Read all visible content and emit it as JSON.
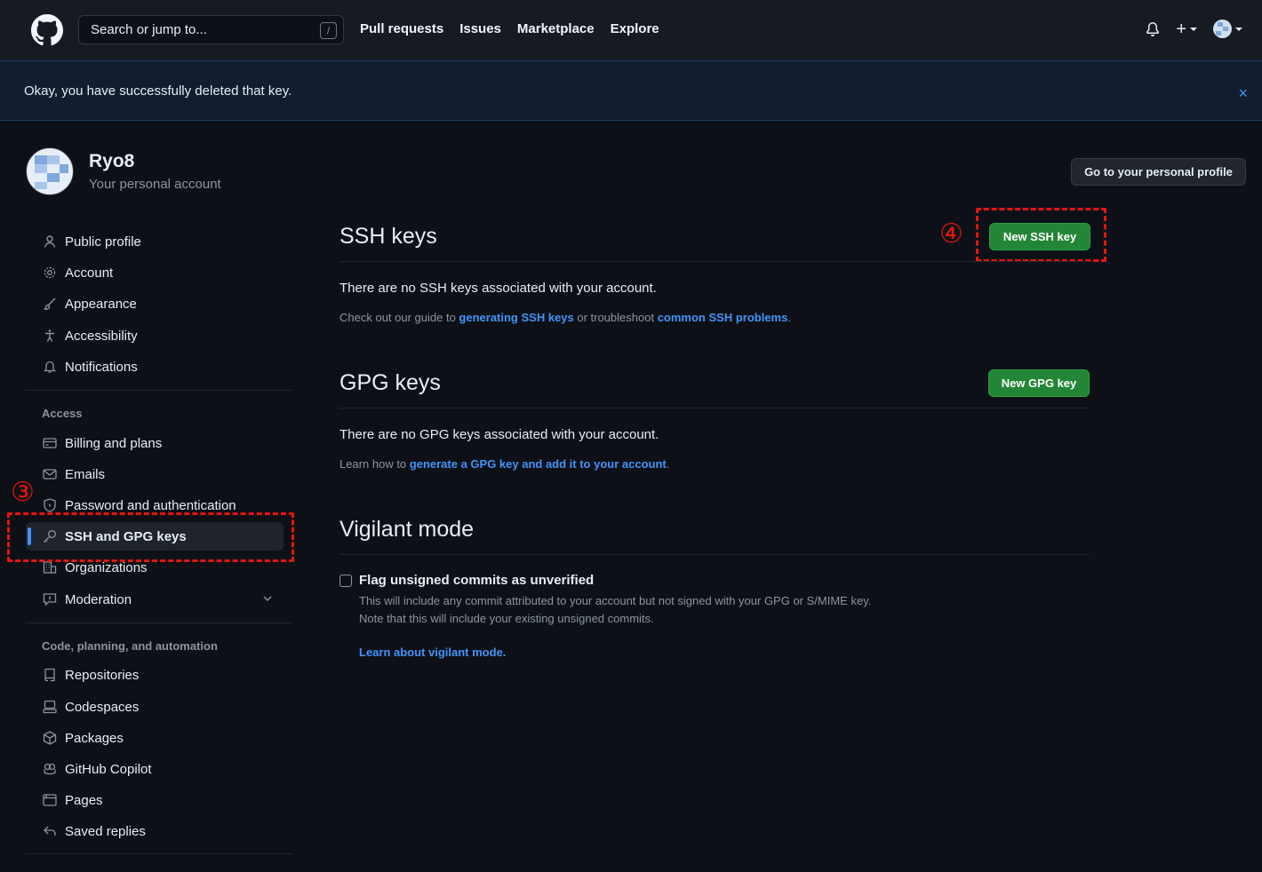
{
  "header": {
    "search_placeholder": "Search or jump to...",
    "search_shortcut": "/",
    "nav": [
      "Pull requests",
      "Issues",
      "Marketplace",
      "Explore"
    ],
    "plus": "+"
  },
  "flash": {
    "message": "Okay, you have successfully deleted that key.",
    "close": "×"
  },
  "account": {
    "name": "Ryo8",
    "subtitle": "Your personal account",
    "profile_button": "Go to your personal profile"
  },
  "sidebar": {
    "items_top": [
      "Public profile",
      "Account",
      "Appearance",
      "Accessibility",
      "Notifications"
    ],
    "access_heading": "Access",
    "items_access": [
      "Billing and plans",
      "Emails",
      "Password and authentication",
      "SSH and GPG keys",
      "Organizations",
      "Moderation"
    ],
    "code_heading": "Code, planning, and automation",
    "items_code": [
      "Repositories",
      "Codespaces",
      "Packages",
      "GitHub Copilot",
      "Pages",
      "Saved replies"
    ]
  },
  "annotations": {
    "step3": "③",
    "step4": "④"
  },
  "ssh": {
    "title": "SSH keys",
    "button": "New SSH key",
    "empty": "There are no SSH keys associated with your account.",
    "note_pre": "Check out our guide to ",
    "note_link1": "generating SSH keys",
    "note_mid": " or troubleshoot ",
    "note_link2": "common SSH problems",
    "note_post": "."
  },
  "gpg": {
    "title": "GPG keys",
    "button": "New GPG key",
    "empty": "There are no GPG keys associated with your account.",
    "note_pre": "Learn how to ",
    "note_link": "generate a GPG key and add it to your account",
    "note_post": "."
  },
  "vigilant": {
    "title": "Vigilant mode",
    "checkbox_label": "Flag unsigned commits as unverified",
    "desc1": "This will include any commit attributed to your account but not signed with your GPG or S/MIME key.",
    "desc2": "Note that this will include your existing unsigned commits.",
    "link": "Learn about vigilant mode."
  }
}
